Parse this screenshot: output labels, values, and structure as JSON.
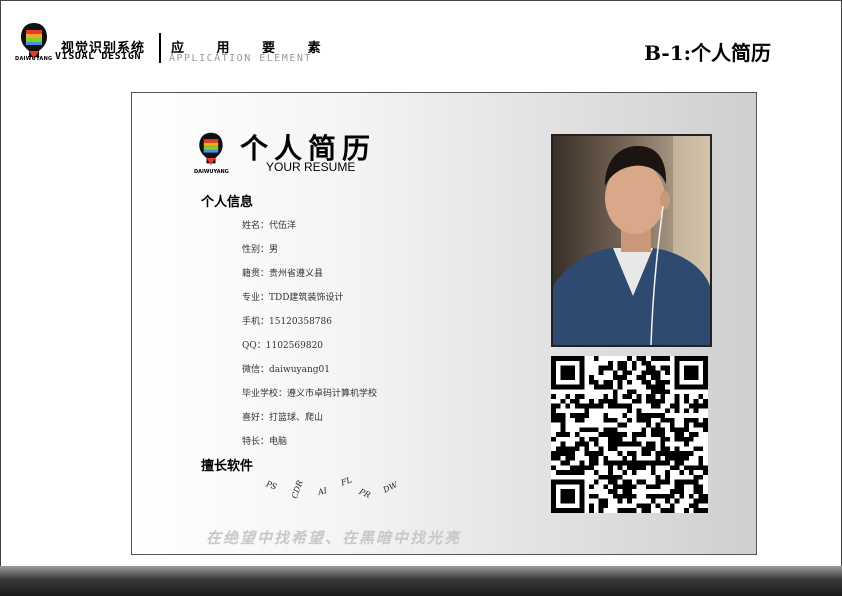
{
  "header": {
    "logo_text": "DAIWUYANG",
    "brand_cn": "视觉识别系统",
    "brand_en": "VISUAL DESIGN",
    "section_cn": "应 用 要 素",
    "section_en": "APPLICATION ELEMENT",
    "page_code": "B-1:个人简历"
  },
  "resume": {
    "logo_text": "DAIWUYANG",
    "title": "个人简历",
    "subtitle": "YOUR RESUME",
    "personal_info_title": "个人信息",
    "info": [
      "姓名：代伍洋",
      "性别：男",
      "籍贯：贵州省遵义县",
      "专业：TDD建筑装饰设计",
      "手机：15120358786",
      "QQ：1102569820",
      "微信：daiwuyang01",
      "毕业学校：遵义市卓码计算机学校",
      "喜好：打篮球、爬山",
      "特长：电脑"
    ],
    "skills_title": "擅长软件",
    "software": [
      "PS",
      "CDR",
      "AI",
      "FL",
      "PR",
      "DW"
    ],
    "slogan": "在绝望中找希望、在黑暗中找光亮"
  },
  "colors": {
    "bottom_bar": "#2a2a2a",
    "slogan": "#c8c8c8"
  }
}
